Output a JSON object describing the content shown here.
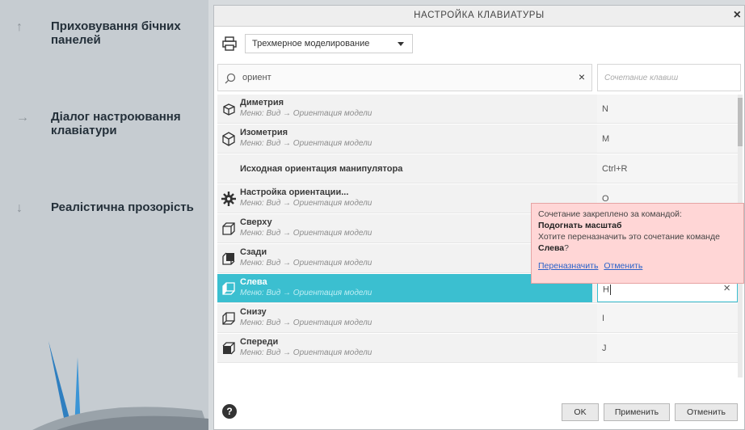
{
  "left_panel": {
    "features": [
      {
        "arrow": "🡑",
        "text": "Приховування бічних панелей"
      },
      {
        "arrow": "🡒",
        "text": "Діалог настроювання клавіатури"
      },
      {
        "arrow": "🡓",
        "text": "Реалістична прозорість"
      }
    ]
  },
  "dialog": {
    "title": "НАСТРОЙКА КЛАВИАТУРЫ",
    "close": "×",
    "preset": "Трехмерное моделирование",
    "search_value": "ориент",
    "search_clear": "×",
    "shortcut_placeholder": "Сочетание клавиш",
    "rows": [
      {
        "name": "Диметрия",
        "menu": "Меню: Вид → Ориентация модели",
        "key": "N",
        "icon": "cube-icon"
      },
      {
        "name": "Изометрия",
        "menu": "Меню: Вид → Ориентация модели",
        "key": "M",
        "icon": "iso-cube-icon"
      },
      {
        "name": "Исходная ориентация манипулятора",
        "menu": "",
        "key": "Ctrl+R",
        "icon": ""
      },
      {
        "name": "Настройка ориентации...",
        "menu": "Меню: Вид → Ориентация модели",
        "key": "O",
        "icon": "gear-icon"
      },
      {
        "name": "Сверху",
        "menu": "Меню: Вид → Ориентация модели",
        "key": "",
        "icon": "view-top-icon"
      },
      {
        "name": "Сзади",
        "menu": "Меню: Вид → Ориентация модели",
        "key": "",
        "icon": "view-back-icon"
      },
      {
        "name": "Слева",
        "menu": "Меню: Вид → Ориентация модели",
        "key": "H",
        "icon": "view-left-icon"
      },
      {
        "name": "Снизу",
        "menu": "Меню: Вид → Ориентация модели",
        "key": "I",
        "icon": "view-bottom-icon"
      },
      {
        "name": "Спереди",
        "menu": "Меню: Вид → Ориентация модели",
        "key": "J",
        "icon": "view-front-icon"
      }
    ],
    "conflict": {
      "line1": "Сочетание закреплено за командой:",
      "command": "Подогнать масштаб",
      "line3": "Хотите переназначить это сочетание команде",
      "target": "Слева",
      "q": "?",
      "reassign": "Переназначить",
      "cancel": "Отменить"
    },
    "buttons": {
      "help": "?",
      "ok": "OK",
      "apply": "Применить",
      "cancel": "Отменить"
    }
  },
  "colors": {
    "selection": "#3bbfd0",
    "conflict_bg": "#ffd6d6",
    "panel_bg": "#c6ccd1"
  }
}
